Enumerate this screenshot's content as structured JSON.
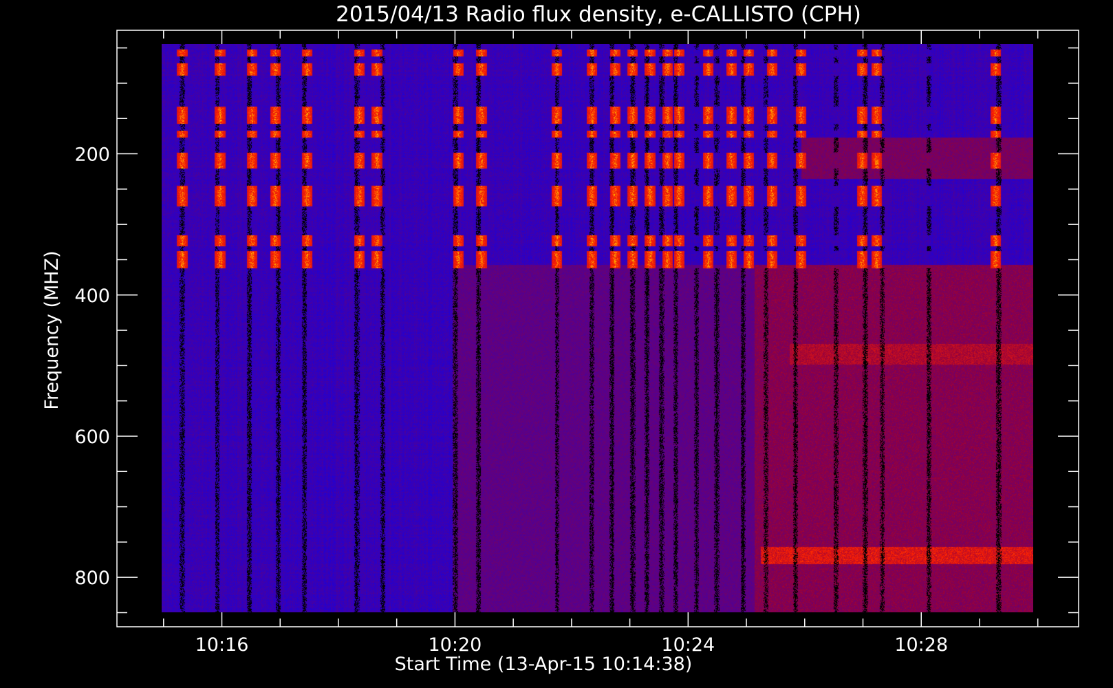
{
  "chart_data": {
    "type": "heatmap",
    "title": "2015/04/13  Radio flux density, e-CALLISTO (CPH)",
    "xlabel": "Start Time (13-Apr-15 10:14:38)",
    "ylabel": "Frequency (MHZ)",
    "x_ticks": [
      "10:16",
      "10:20",
      "10:24",
      "10:28"
    ],
    "x_tick_minutes": [
      16,
      20,
      24,
      28
    ],
    "x_range_minutes": [
      14.2,
      30.7
    ],
    "data_x_range_minutes": [
      15.0,
      30.0
    ],
    "y_ticks": [
      200,
      400,
      600,
      800
    ],
    "y_range_mhz": [
      25,
      870
    ],
    "data_y_range_mhz": [
      45,
      870
    ],
    "y_reversed": true,
    "colors": {
      "background": "#000000",
      "axis": "#ffffff",
      "low": "#0000ff",
      "mid": "#900040",
      "high": "#ff2000",
      "peak": "#ffc000"
    },
    "burst_bands_mhz": [
      [
        52,
        62
      ],
      [
        72,
        90
      ],
      [
        135,
        160
      ],
      [
        170,
        180
      ],
      [
        202,
        225
      ],
      [
        250,
        280
      ],
      [
        322,
        338
      ],
      [
        345,
        370
      ]
    ],
    "dark_columns_minutes": [
      15.35,
      15.95,
      16.5,
      17.0,
      17.45,
      18.35,
      18.8,
      20.05,
      20.45,
      21.8,
      22.4,
      22.75,
      23.1,
      23.35,
      23.6,
      23.85,
      24.2,
      24.55,
      25.0,
      25.4,
      25.9,
      26.6,
      27.1,
      27.4,
      28.2,
      29.4
    ],
    "burst_columns_minutes": [
      15.35,
      16.0,
      16.55,
      16.95,
      17.5,
      18.4,
      18.7,
      20.1,
      20.5,
      21.8,
      22.4,
      22.8,
      23.1,
      23.4,
      23.7,
      23.9,
      24.4,
      24.8,
      25.1,
      25.5,
      26.0,
      27.05,
      27.3,
      29.35
    ],
    "elevated_regions": [
      {
        "minutes": [
          20.0,
          30.0
        ],
        "mhz": [
          365,
          870
        ],
        "level": 0.35
      },
      {
        "minutes": [
          25.2,
          30.0
        ],
        "mhz": [
          365,
          870
        ],
        "level": 0.5
      },
      {
        "minutes": [
          25.3,
          30.0
        ],
        "mhz": [
          775,
          800
        ],
        "level": 0.8
      },
      {
        "minutes": [
          25.8,
          30.0
        ],
        "mhz": [
          480,
          510
        ],
        "level": 0.65
      },
      {
        "minutes": [
          26.0,
          30.0
        ],
        "mhz": [
          180,
          240
        ],
        "level": 0.45
      }
    ]
  }
}
